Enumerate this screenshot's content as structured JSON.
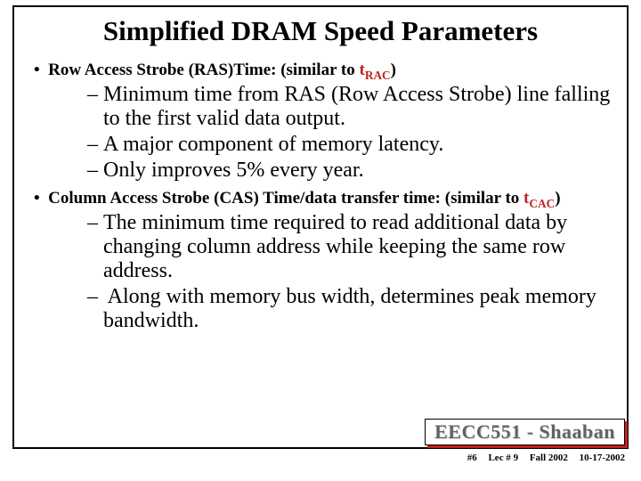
{
  "title": "Simplified DRAM Speed Parameters",
  "bullets": {
    "b1": {
      "lead": "Row Access Strobe (RAS)Time: (similar to ",
      "term_main": "t",
      "term_sub": "RAC",
      "tail": ")",
      "items": [
        "Minimum time from RAS (Row Access Strobe) line falling to the first valid data output.",
        "A major component of memory latency.",
        "Only improves 5% every year."
      ]
    },
    "b2": {
      "lead": "Column Access Strobe (CAS) Time/data transfer time: (similar to ",
      "term_main": "t",
      "term_sub": "CAC",
      "tail": ")",
      "items": [
        "The minimum time required to read additional data by changing column address while keeping the same row address.",
        " Along with memory bus width, determines peak memory bandwidth."
      ]
    }
  },
  "footer": {
    "course": "EECC551 - Shaaban",
    "page": "#6",
    "lec": "Lec # 9",
    "term": "Fall 2002",
    "date": "10-17-2002"
  }
}
